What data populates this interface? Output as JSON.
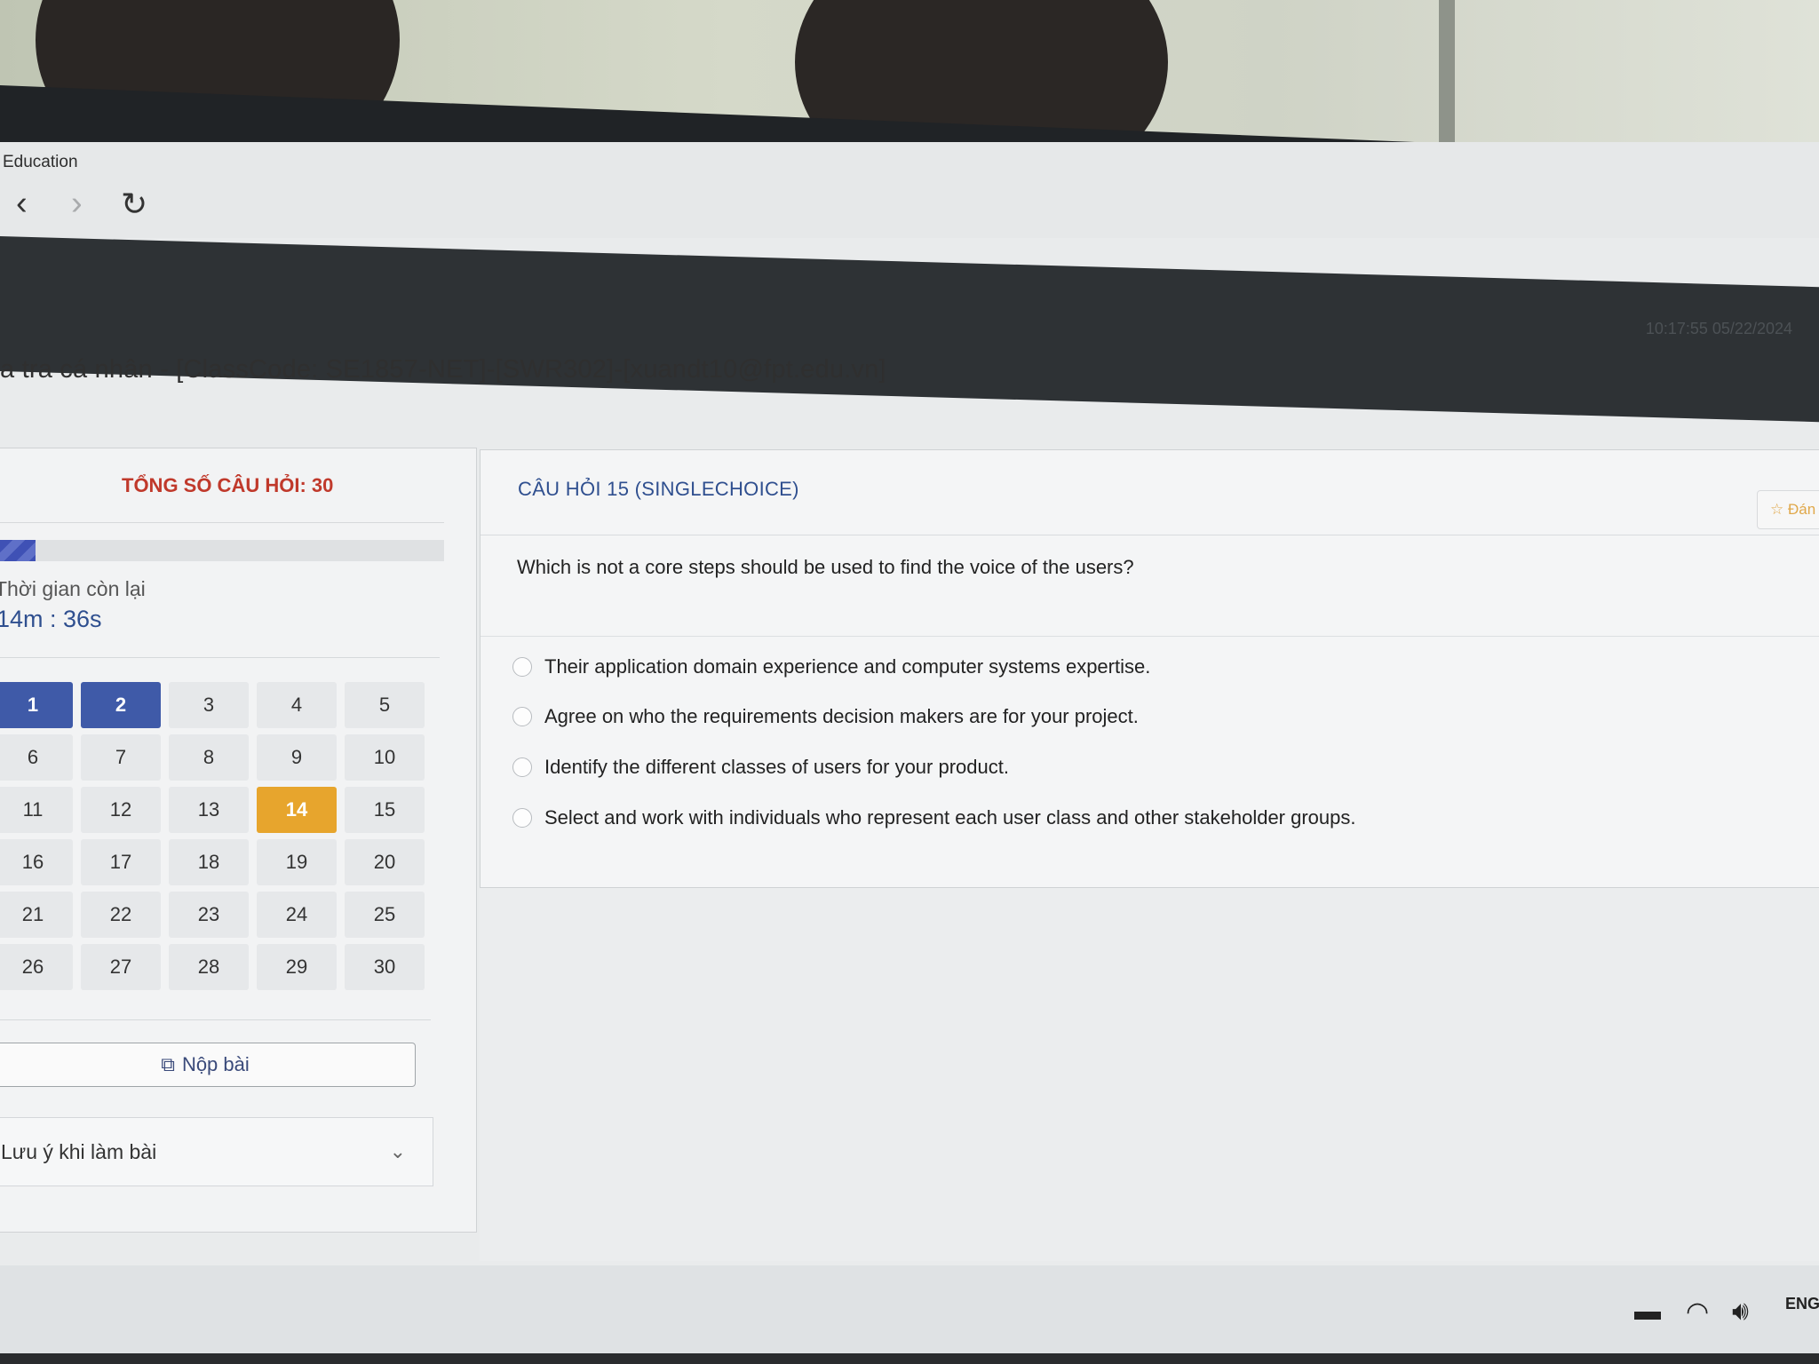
{
  "browser": {
    "tab_title": "Education",
    "nav": {
      "back_icon": "‹",
      "forward_icon": "›",
      "reload_icon": "↻"
    }
  },
  "page": {
    "title": "a tra cá nhân - [ClassCode: SE1857-NET]-[SWR302]-[xuandt10@fpt.edu.vn]",
    "clock": "10:17:55 05/22/2024"
  },
  "sidebar": {
    "total_label": "TỔNG SỐ CÂU HỎI: 30",
    "progress_fraction": 0.08,
    "time_label": "Thời gian còn lại",
    "time_value": "14m : 36s",
    "questions": [
      {
        "n": "1",
        "state": "answered"
      },
      {
        "n": "2",
        "state": "answered"
      },
      {
        "n": "3",
        "state": "none"
      },
      {
        "n": "4",
        "state": "none"
      },
      {
        "n": "5",
        "state": "none"
      },
      {
        "n": "6",
        "state": "none"
      },
      {
        "n": "7",
        "state": "none"
      },
      {
        "n": "8",
        "state": "none"
      },
      {
        "n": "9",
        "state": "none"
      },
      {
        "n": "10",
        "state": "none"
      },
      {
        "n": "11",
        "state": "none"
      },
      {
        "n": "12",
        "state": "none"
      },
      {
        "n": "13",
        "state": "none"
      },
      {
        "n": "14",
        "state": "flagged"
      },
      {
        "n": "15",
        "state": "none"
      },
      {
        "n": "16",
        "state": "none"
      },
      {
        "n": "17",
        "state": "none"
      },
      {
        "n": "18",
        "state": "none"
      },
      {
        "n": "19",
        "state": "none"
      },
      {
        "n": "20",
        "state": "none"
      },
      {
        "n": "21",
        "state": "none"
      },
      {
        "n": "22",
        "state": "none"
      },
      {
        "n": "23",
        "state": "none"
      },
      {
        "n": "24",
        "state": "none"
      },
      {
        "n": "25",
        "state": "none"
      },
      {
        "n": "26",
        "state": "none"
      },
      {
        "n": "27",
        "state": "none"
      },
      {
        "n": "28",
        "state": "none"
      },
      {
        "n": "29",
        "state": "none"
      },
      {
        "n": "30",
        "state": "none"
      }
    ],
    "submit_label": "Nộp bài",
    "notes_label": "Lưu ý khi làm bài"
  },
  "question": {
    "title": "CÂU HỎI 15 (SINGLECHOICE)",
    "flag_label": "☆ Đán",
    "text": "Which is not a core steps should be used to find the voice of the users?",
    "options": [
      "Their application domain experience and computer systems expertise.",
      "Agree on who the requirements decision makers are for your project.",
      "Identify the different classes of users for your product.",
      "Select and work with individuals who represent each user class and other stakeholder groups."
    ]
  },
  "taskbar": {
    "lang": "ENG"
  },
  "colors": {
    "accent": "#3f5aa8",
    "flagged": "#e7a52d",
    "total_label": "#c0392b",
    "appbar": "#2e3235"
  }
}
